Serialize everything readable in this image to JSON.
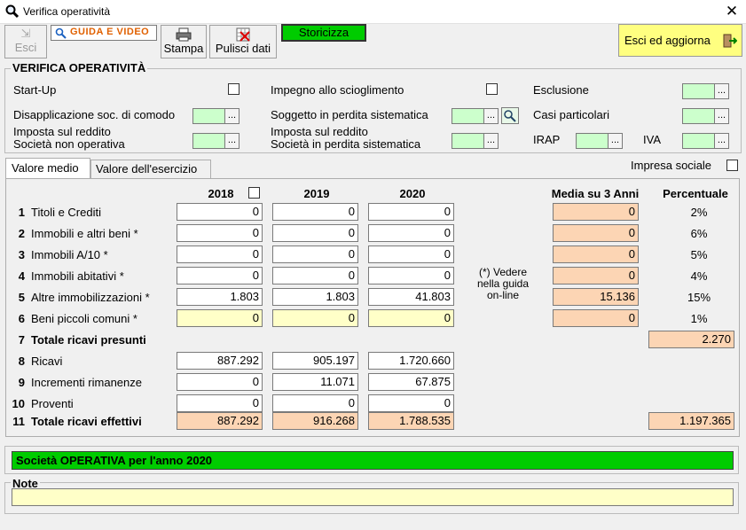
{
  "window": {
    "title": "Verifica operatività"
  },
  "toolbar": {
    "esci": "Esci",
    "guida": "GUIDA E VIDEO",
    "stampa": "Stampa",
    "pulisci": "Pulisci dati",
    "storicizza": "Storicizza",
    "esci_aggiorna": "Esci ed aggiorna"
  },
  "section": {
    "title": "VERIFICA OPERATIVITÀ",
    "start_up": "Start-Up",
    "impegno": "Impegno allo scioglimento",
    "esclusione": "Esclusione",
    "disapplicazione": "Disapplicazione soc. di comodo",
    "soggetto": "Soggetto in perdita sistematica",
    "casi": "Casi particolari",
    "imposta1_l1": "Imposta sul reddito",
    "imposta1_l2": "Società non operativa",
    "imposta2_l1": "Imposta sul reddito",
    "imposta2_l2": "Società in perdita sistematica",
    "irap": "IRAP",
    "iva": "IVA",
    "dots": "..."
  },
  "tabs": {
    "medio": "Valore medio",
    "esercizio": "Valore dell'esercizio"
  },
  "impresa_sociale": "Impresa sociale",
  "table": {
    "years": [
      "2018",
      "2019",
      "2020"
    ],
    "media_header": "Media su 3 Anni",
    "perc_header": "Percentuale",
    "note_text": [
      "(*) Vedere",
      "nella guida",
      "on-line"
    ],
    "rows": [
      {
        "num": "1",
        "label": "Titoli e Crediti",
        "v": [
          "0",
          "0",
          "0"
        ],
        "media": "0",
        "perc": "2%"
      },
      {
        "num": "2",
        "label": "Immobili e altri beni *",
        "v": [
          "0",
          "0",
          "0"
        ],
        "media": "0",
        "perc": "6%"
      },
      {
        "num": "3",
        "label": "Immobili A/10 *",
        "v": [
          "0",
          "0",
          "0"
        ],
        "media": "0",
        "perc": "5%"
      },
      {
        "num": "4",
        "label": "Immobili abitativi *",
        "v": [
          "0",
          "0",
          "0"
        ],
        "media": "0",
        "perc": "4%"
      },
      {
        "num": "5",
        "label": "Altre immobilizzazioni *",
        "v": [
          "1.803",
          "1.803",
          "41.803"
        ],
        "media": "15.136",
        "perc": "15%"
      },
      {
        "num": "6",
        "label": "Beni piccoli comuni *",
        "v": [
          "0",
          "0",
          "0"
        ],
        "media": "0",
        "perc": "1%"
      },
      {
        "num": "7",
        "label": "Totale ricavi presunti",
        "total": "2.270"
      },
      {
        "num": "8",
        "label": "Ricavi",
        "v": [
          "887.292",
          "905.197",
          "1.720.660"
        ]
      },
      {
        "num": "9",
        "label": "Incrementi rimanenze",
        "v": [
          "0",
          "11.071",
          "67.875"
        ]
      },
      {
        "num": "10",
        "label": "Proventi",
        "v": [
          "0",
          "0",
          "0"
        ]
      },
      {
        "num": "11",
        "label": "Totale ricavi effettivi",
        "v": [
          "887.292",
          "916.268",
          "1.788.535"
        ],
        "total": "1.197.365"
      }
    ]
  },
  "status": "Società OPERATIVA per l'anno 2020",
  "note_label": "Note",
  "colors": {
    "green_status": "#00cc00",
    "orange": "#fcd5b4",
    "yellow": "#ffffc8",
    "light_green": "#ccffcc"
  }
}
